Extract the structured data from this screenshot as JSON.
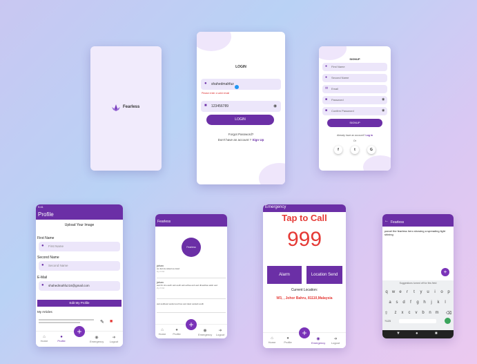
{
  "splash": {
    "logo_text": "Fearless"
  },
  "login": {
    "title": "LOGIN",
    "email_value": "shahedmahfuz",
    "email_hint": "Please enter a valid email",
    "password_value": "123456789",
    "login_label": "LOGIN",
    "forgot_label": "Forgot Password?",
    "signup_prompt": "Don't have an account ?",
    "signup_link": "Sign Up"
  },
  "signup": {
    "title": "SIGNUP",
    "fields": [
      "First Name",
      "Second Name",
      "Email",
      "Password",
      "Confirm Password"
    ],
    "button_label": "SIGNUP",
    "login_prompt": "Already have an account?",
    "login_link": "Log in",
    "or_text": "Or",
    "social": [
      "f",
      "t",
      "G"
    ]
  },
  "profile": {
    "status_time": "9:41",
    "title": "Profile",
    "upload_label": "Upload Your Image",
    "first_name_label": "First Name",
    "first_name_placeholder": "First Name",
    "second_name_label": "Second Name",
    "second_name_placeholder": "Second Name",
    "email_label": "E-Mail",
    "email_value": "shahedmahfuz16@gmail.com",
    "edit_button": "Edit My Profile",
    "articles_label": "My Articles",
    "nav": [
      "Home",
      "Profile",
      "",
      "Emergency",
      "Logout"
    ]
  },
  "feed": {
    "title": "Fearless",
    "avatar_text": "Fearless",
    "posts": [
      {
        "author": "johan",
        "text": "as dsd da sdasd as dasd",
        "time": "2y 2 Oct"
      },
      {
        "author": "johan",
        "text": "asd hb shu asdh asb asdh asb adhsa asb asd dhasdbas adsb asd",
        "time": "2y 2 Oct"
      },
      {
        "author": "",
        "text": "asd asdbasd asdsd asd bas asd dasd asdasb asdb",
        "time": ""
      }
    ],
    "nav": [
      "Home",
      "Profile",
      "",
      "Emergency",
      "Logout"
    ]
  },
  "emergency": {
    "title": "Emergency",
    "tap_label": "Tap to Call",
    "number": "999",
    "alarm_label": "Alarm",
    "location_label": "Location Send",
    "current_label": "Current Location:",
    "location_value": "W3, , Johor Bahru, 81110,Malaysia",
    "nav": [
      "Home",
      "Profile",
      "",
      "Emergency",
      "Logout"
    ]
  },
  "editor": {
    "title": "Fearless",
    "text": "parcel the fearless hero showing a spreading light shining",
    "suggestion": "Suggestions turned off for this field",
    "row1": [
      "q",
      "w",
      "e",
      "r",
      "t",
      "y",
      "u",
      "i",
      "o",
      "p"
    ],
    "row2": [
      "a",
      "s",
      "d",
      "f",
      "g",
      "h",
      "j",
      "k",
      "l"
    ],
    "row3": [
      "z",
      "x",
      "c",
      "v",
      "b",
      "n",
      "m"
    ],
    "sym_key": "?123"
  },
  "colors": {
    "primary": "#6b2fa6",
    "accent": "#e53935",
    "field": "#ece6fa"
  }
}
